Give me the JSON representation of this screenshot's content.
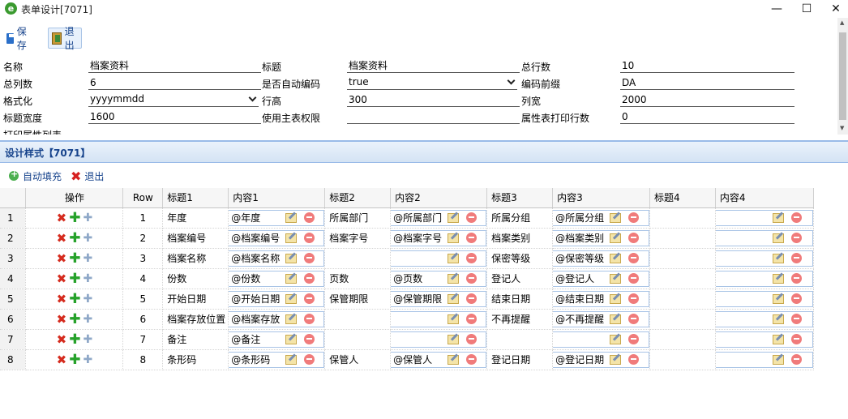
{
  "window": {
    "title": "表单设计[7071]",
    "minimize": "—",
    "maximize": "☐",
    "close": "✕"
  },
  "toolbar": {
    "save_label": "保存",
    "exit_label": "退出"
  },
  "form": {
    "name_label": "名称",
    "name_value": "档案资料",
    "title_label": "标题",
    "title_value": "档案资料",
    "total_rows_label": "总行数",
    "total_rows_value": "10",
    "total_cols_label": "总列数",
    "total_cols_value": "6",
    "auto_code_label": "是否自动编码",
    "auto_code_value": "true",
    "code_prefix_label": "编码前缀",
    "code_prefix_value": "DA",
    "format_label": "格式化",
    "format_value": "yyyymmdd",
    "row_height_label": "行高",
    "row_height_value": "300",
    "col_width_label": "列宽",
    "col_width_value": "2000",
    "title_width_label": "标题宽度",
    "title_width_value": "1600",
    "main_perm_label": "使用主表权限",
    "main_perm_value": "",
    "attr_print_label": "属性表打印行数",
    "attr_print_value": "0",
    "print_attr_label": "打印属性列表"
  },
  "panel": {
    "title": "设计样式【7071】",
    "autofill_label": "自动填充",
    "exit_label": "退出"
  },
  "grid": {
    "headers": {
      "ops": "操作",
      "row": "Row",
      "t1": "标题1",
      "c1": "内容1",
      "t2": "标题2",
      "c2": "内容2",
      "t3": "标题3",
      "c3": "内容3",
      "t4": "标题4",
      "c4": "内容4"
    },
    "rows": [
      {
        "n": "1",
        "row": "1",
        "t1": "年度",
        "c1": "@年度",
        "t2": "所属部门",
        "c2": "@所属部门",
        "t3": "所属分组",
        "c3": "@所属分组",
        "t4": "",
        "c4": ""
      },
      {
        "n": "2",
        "row": "2",
        "t1": "档案编号",
        "c1": "@档案编号",
        "t2": "档案字号",
        "c2": "@档案字号",
        "t3": "档案类别",
        "c3": "@档案类别",
        "t4": "",
        "c4": ""
      },
      {
        "n": "3",
        "row": "3",
        "t1": "档案名称",
        "c1": "@档案名称",
        "t2": "",
        "c2": "",
        "t3": "保密等级",
        "c3": "@保密等级",
        "t4": "",
        "c4": ""
      },
      {
        "n": "4",
        "row": "4",
        "t1": "份数",
        "c1": "@份数",
        "t2": "页数",
        "c2": "@页数",
        "t3": "登记人",
        "c3": "@登记人",
        "t4": "",
        "c4": ""
      },
      {
        "n": "5",
        "row": "5",
        "t1": "开始日期",
        "c1": "@开始日期",
        "t2": "保管期限",
        "c2": "@保管期限",
        "t3": "结束日期",
        "c3": "@结束日期",
        "t4": "",
        "c4": ""
      },
      {
        "n": "6",
        "row": "6",
        "t1": "档案存放位置",
        "c1": "@档案存放",
        "t2": "",
        "c2": "",
        "t3": "不再提醒",
        "c3": "@不再提醒",
        "t4": "",
        "c4": ""
      },
      {
        "n": "7",
        "row": "7",
        "t1": "备注",
        "c1": "@备注",
        "t2": "",
        "c2": "",
        "t3": "",
        "c3": "",
        "t4": "",
        "c4": ""
      },
      {
        "n": "8",
        "row": "8",
        "t1": "条形码",
        "c1": "@条形码",
        "t2": "保管人",
        "c2": "@保管人",
        "t3": "登记日期",
        "c3": "@登记日期",
        "t4": "",
        "c4": ""
      }
    ]
  },
  "icons": {
    "app": "ie-icon",
    "save": "floppy-icon",
    "exit": "door-exit-icon",
    "delete": "red-x-icon",
    "add": "green-plus-icon",
    "insert": "insert-row-icon",
    "edit": "pencil-icon",
    "remove": "minus-circle-icon"
  }
}
